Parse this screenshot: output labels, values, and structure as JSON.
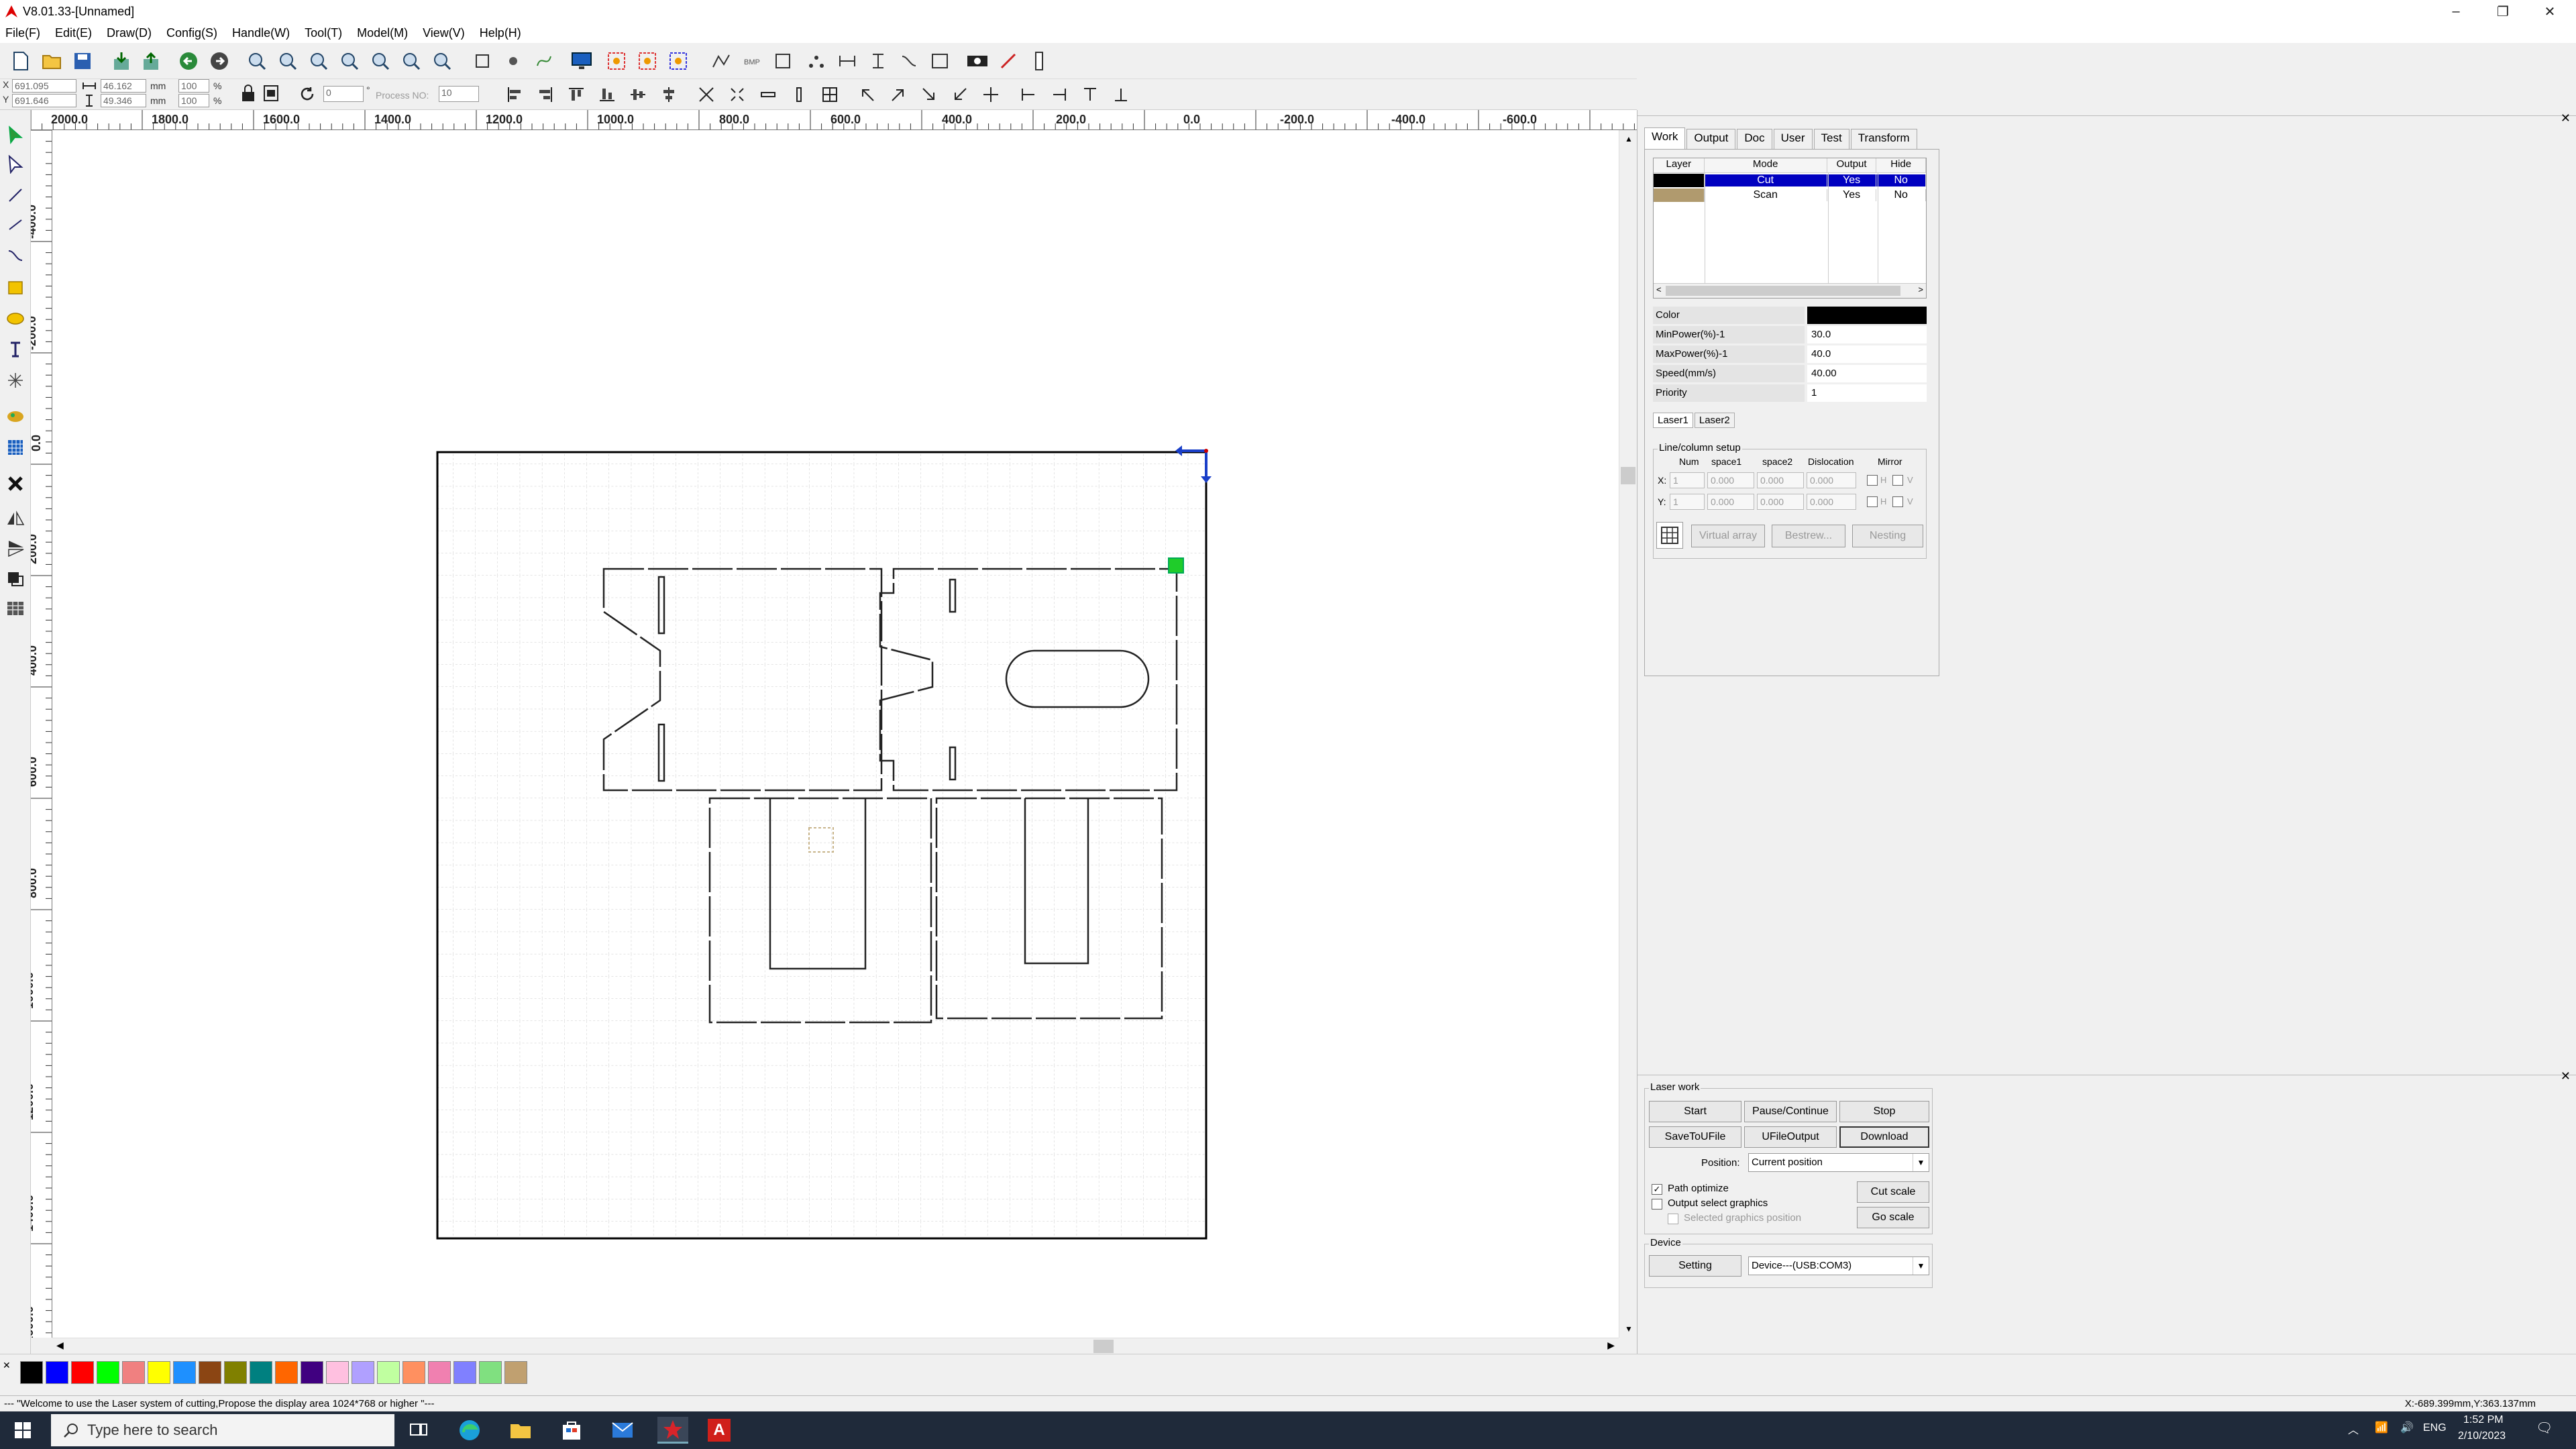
{
  "window": {
    "title": "V8.01.33-[Unnamed]",
    "minimize": "–",
    "restore": "❐",
    "close": "✕"
  },
  "menu": [
    "File(F)",
    "Edit(E)",
    "Draw(D)",
    "Config(S)",
    "Handle(W)",
    "Tool(T)",
    "Model(M)",
    "View(V)",
    "Help(H)"
  ],
  "coords": {
    "x_label": "X",
    "y_label": "Y",
    "x_value": "691.095",
    "y_value": "691.646",
    "unit": "mm",
    "w_value": "46.162",
    "h_value": "49.346",
    "scale_w": "100",
    "scale_h": "100",
    "percent": "%",
    "rotate_value": "0",
    "degree": "°",
    "process_label": "Process NO:",
    "process_value": "10"
  },
  "ruler": {
    "h_labels": [
      "2000.0",
      "1800.0",
      "1600.0",
      "1400.0",
      "1200.0",
      "1000.0",
      "800.0",
      "600.0",
      "400.0",
      "200.0",
      "0.0",
      "-200.0",
      "-400.0",
      "-600.0"
    ],
    "v_labels": [
      "-400.0",
      "-200.0",
      "0.0",
      "200.0",
      "400.0",
      "600.0",
      "800.0",
      "1000.0",
      "1200.0",
      "1400.0",
      "1600.0"
    ]
  },
  "right_panel": {
    "tabs": [
      "Work",
      "Output",
      "Doc",
      "User",
      "Test",
      "Transform"
    ],
    "active_tab": "Work",
    "layer_table": {
      "headers": [
        "Layer",
        "Mode",
        "Output",
        "Hide"
      ],
      "rows": [
        {
          "color": "#000000",
          "mode": "Cut",
          "output": "Yes",
          "hide": "No",
          "selected": true
        },
        {
          "color": "#b09a6e",
          "mode": "Scan",
          "output": "Yes",
          "hide": "No",
          "selected": false
        }
      ]
    },
    "properties": [
      {
        "label": "Color",
        "value": ""
      },
      {
        "label": "MinPower(%)-1",
        "value": "30.0"
      },
      {
        "label": "MaxPower(%)-1",
        "value": "40.0"
      },
      {
        "label": "Speed(mm/s)",
        "value": "40.00"
      },
      {
        "label": "Priority",
        "value": "1"
      }
    ],
    "laser_tabs": [
      "Laser1",
      "Laser2"
    ],
    "array_setup": {
      "title": "Line/column setup",
      "headers": [
        "Num",
        "space1",
        "space2",
        "Dislocation",
        "Mirror"
      ],
      "x_label": "X:",
      "y_label": "Y:",
      "x_values": [
        "1",
        "0.000",
        "0.000",
        "0.000"
      ],
      "y_values": [
        "1",
        "0.000",
        "0.000",
        "0.000"
      ],
      "mirror_h": "H",
      "mirror_v": "V",
      "buttons": [
        "Virtual array",
        "Bestrew...",
        "Nesting"
      ]
    }
  },
  "laser_work": {
    "title": "Laser work",
    "start": "Start",
    "pause": "Pause/Continue",
    "stop": "Stop",
    "save_to_file": "SaveToUFile",
    "ufile_output": "UFileOutput",
    "download": "Download",
    "position_label": "Position:",
    "position_value": "Current position",
    "path_optimize": "Path optimize",
    "output_select": "Output select graphics",
    "selected_position": "Selected graphics position",
    "cut_scale": "Cut scale",
    "go_scale": "Go scale",
    "path_optimize_checked": "✓"
  },
  "device": {
    "title": "Device",
    "setting": "Setting",
    "device_value": "Device---(USB:COM3)"
  },
  "palette": [
    "#000000",
    "#0000ff",
    "#ff0000",
    "#00ff00",
    "#f08080",
    "#ffff00",
    "#1e90ff",
    "#8b4513",
    "#808000",
    "#008080",
    "#ff6600",
    "#400080",
    "#ffc0e0",
    "#b0a0ff",
    "#c0ffa0",
    "#ff9060",
    "#f080b0",
    "#8080ff",
    "#80e080",
    "#c0a070"
  ],
  "status": {
    "message": "--- \"Welcome to use the Laser system of cutting,Propose the display area 1024*768 or higher \"---",
    "coords": "X:-689.399mm,Y:363.137mm"
  },
  "taskbar": {
    "search_placeholder": "Type here to search",
    "time": "1:52 PM",
    "date": "2/10/2023",
    "lang": "ENG",
    "a_label": "A"
  }
}
